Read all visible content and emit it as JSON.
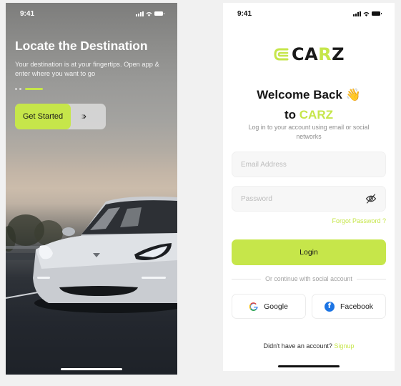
{
  "onboarding": {
    "status_time": "9:41",
    "title": "Locate the Destination",
    "subtitle": "Your destination is at your fingertips. Open app & enter where you want to go",
    "pager": {
      "total": 3,
      "active": 3
    },
    "cta_label": "Get Started",
    "arrows": [
      "›",
      "›",
      "›"
    ]
  },
  "login": {
    "status_time": "9:41",
    "logo": {
      "prefix": "CA",
      "accent": "R",
      "suffix": "Z"
    },
    "welcome_line1": "Welcome Back",
    "welcome_emoji": "👋",
    "welcome_to": "to",
    "welcome_brand": "CARZ",
    "subtitle": "Log in to your account using email or social networks",
    "email": {
      "placeholder": "Email Address",
      "value": ""
    },
    "password": {
      "placeholder": "Password",
      "value": ""
    },
    "forgot_label": "Forgot Password ?",
    "login_label": "Login",
    "divider_label": "Or continue with social account",
    "social": {
      "google_label": "Google",
      "facebook_label": "Facebook"
    },
    "signup_prompt": "Didn't have an account?",
    "signup_link": "Signup"
  },
  "colors": {
    "accent": "#c6e64a",
    "text_dark": "#161616",
    "muted": "#8d8d8d",
    "facebook": "#1b74e4"
  }
}
